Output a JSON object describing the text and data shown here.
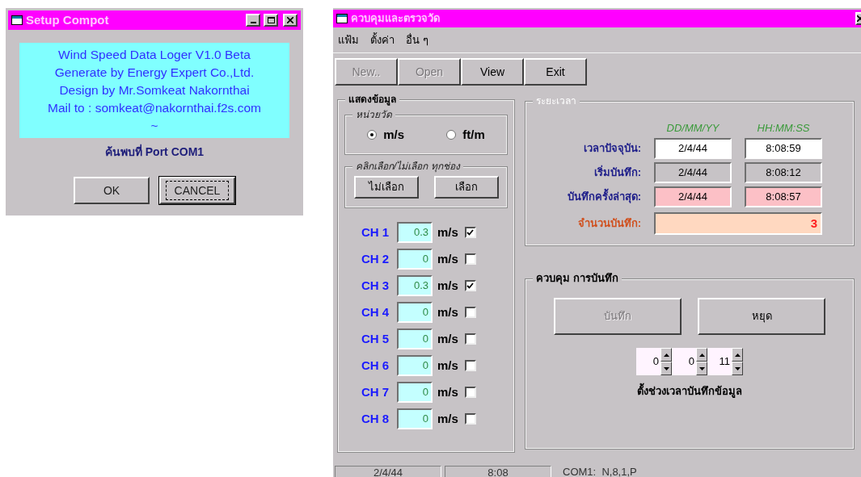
{
  "setup_window": {
    "title": "Setup Compot",
    "info_lines": [
      "Wind Speed Data Loger V1.0 Beta",
      "Generate by Energy Expert Co.,Ltd.",
      "Design by Mr.Somkeat Nakornthai",
      "Mail to : somkeat@nakornthai.f2s.com",
      "~"
    ],
    "status": "ค้นพบที่ Port COM1",
    "buttons": [
      {
        "label": "OK",
        "focused": false
      },
      {
        "label": "CANCEL",
        "focused": true
      }
    ]
  },
  "main_window": {
    "title": "ควบคุมและตรวจวัด",
    "menu": [
      "แฟ้ม",
      "ตั้งค่า",
      "อื่น ๆ"
    ],
    "toolbar": [
      {
        "label": "New..",
        "disabled": true
      },
      {
        "label": "Open",
        "disabled": true
      },
      {
        "label": "View",
        "disabled": false
      },
      {
        "label": "Exit",
        "disabled": false
      }
    ],
    "display_group": {
      "title": "แสดงข้อมูล",
      "units": {
        "title": "หน่วยวัด",
        "options": [
          {
            "label": "m/s",
            "selected": true
          },
          {
            "label": "ft/m",
            "selected": false
          }
        ]
      },
      "select_all": {
        "title": "คลิกเลือก/ไม่เลือก ทุกช่อง",
        "buttons": [
          "ไม่เลือก",
          "เลือก"
        ]
      },
      "channels": [
        {
          "name": "CH 1",
          "value": "0.3",
          "unit": "m/s",
          "checked": true
        },
        {
          "name": "CH 2",
          "value": "0",
          "unit": "m/s",
          "checked": false
        },
        {
          "name": "CH 3",
          "value": "0.3",
          "unit": "m/s",
          "checked": true
        },
        {
          "name": "CH 4",
          "value": "0",
          "unit": "m/s",
          "checked": false
        },
        {
          "name": "CH 5",
          "value": "0",
          "unit": "m/s",
          "checked": false
        },
        {
          "name": "CH 6",
          "value": "0",
          "unit": "m/s",
          "checked": false
        },
        {
          "name": "CH 7",
          "value": "0",
          "unit": "m/s",
          "checked": false
        },
        {
          "name": "CH 8",
          "value": "0",
          "unit": "m/s",
          "checked": false
        }
      ]
    },
    "time_group": {
      "title": "ระยะเวลา",
      "columns": [
        "DD/MM/YY",
        "HH:MM:SS"
      ],
      "rows": [
        {
          "label": "เวลาปัจจุบัน:",
          "kind": "current",
          "date": "2/4/44",
          "time": "8:08:59"
        },
        {
          "label": "เริ่มบันทึก:",
          "kind": "start",
          "date": "2/4/44",
          "time": "8:08:12"
        },
        {
          "label": "บันทึกครั้งล่าสุด:",
          "kind": "last",
          "date": "2/4/44",
          "time": "8:08:57"
        }
      ],
      "count": {
        "label": "จำนวนบันทึก:",
        "value": "3"
      }
    },
    "record_group": {
      "title": "ควบคุม การบันทึก",
      "buttons": [
        {
          "label": "บันทึก",
          "disabled": true
        },
        {
          "label": "หยุด",
          "disabled": false
        }
      ],
      "spinners": [
        "0",
        "0",
        "11"
      ],
      "caption": "ตั้งช่วงเวลาบันทึกข้อมูล"
    },
    "status_bar": [
      "2/4/44",
      "8:08",
      "COM1:  N,8,1,P"
    ]
  }
}
